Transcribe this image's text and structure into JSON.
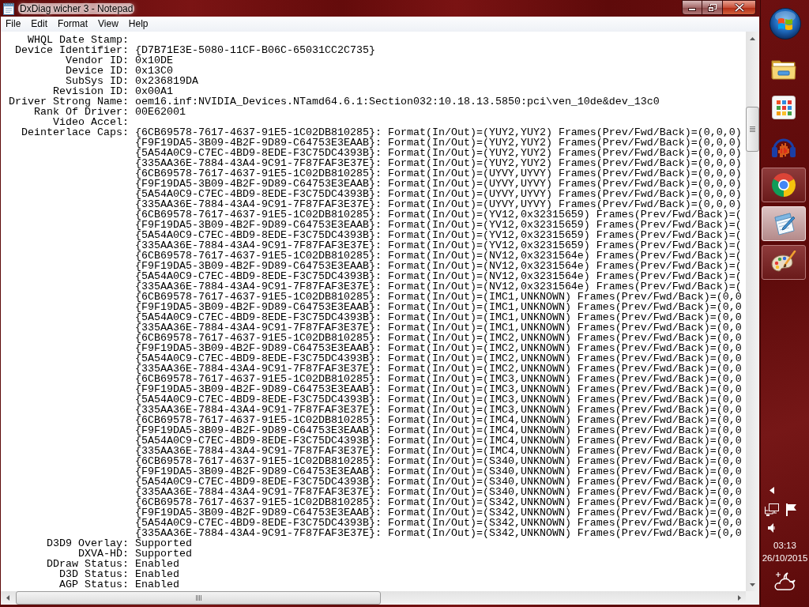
{
  "window": {
    "title": "DxDiag wicher 3 - Notepad"
  },
  "menu": [
    "File",
    "Edit",
    "Format",
    "View",
    "Help"
  ],
  "document": {
    "fields": [
      {
        "label": "WHQL Date Stamp:"
      },
      {
        "label": "Device Identifier:",
        "value": "{D7B71E3E-5080-11CF-B06C-65031CC2C735}"
      },
      {
        "label": "Vendor ID:",
        "value": "0x10DE"
      },
      {
        "label": "Device ID:",
        "value": "0x13C0"
      },
      {
        "label": "SubSys ID:",
        "value": "0x236819DA"
      },
      {
        "label": "Revision ID:",
        "value": "0x00A1"
      },
      {
        "label": "Driver Strong Name:",
        "value": "oem16.inf:NVIDIA_Devices.NTamd64.6.1:Section032:10.18.13.5850:pci\\ven_10de&dev_13c0"
      },
      {
        "label": "Rank Of Driver:",
        "value": "00E62001"
      },
      {
        "label": "Video Accel:"
      },
      {
        "label": "Deinterlace Caps:",
        "values": [
          "{6CB69578-7617-4637-91E5-1C02DB810285}: Format(In/Out)=(YUY2,YUY2) Frames(Prev/Fwd/Back)=(0,0,0)",
          "{F9F19DA5-3B09-4B2F-9D89-C64753E3EAAB}: Format(In/Out)=(YUY2,YUY2) Frames(Prev/Fwd/Back)=(0,0,0)",
          "{5A54A0C9-C7EC-4BD9-8EDE-F3C75DC4393B}: Format(In/Out)=(YUY2,YUY2) Frames(Prev/Fwd/Back)=(0,0,0)",
          "{335AA36E-7884-43A4-9C91-7F87FAF3E37E}: Format(In/Out)=(YUY2,YUY2) Frames(Prev/Fwd/Back)=(0,0,0)",
          "{6CB69578-7617-4637-91E5-1C02DB810285}: Format(In/Out)=(UYVY,UYVY) Frames(Prev/Fwd/Back)=(0,0,0)",
          "{F9F19DA5-3B09-4B2F-9D89-C64753E3EAAB}: Format(In/Out)=(UYVY,UYVY) Frames(Prev/Fwd/Back)=(0,0,0)",
          "{5A54A0C9-C7EC-4BD9-8EDE-F3C75DC4393B}: Format(In/Out)=(UYVY,UYVY) Frames(Prev/Fwd/Back)=(0,0,0)",
          "{335AA36E-7884-43A4-9C91-7F87FAF3E37E}: Format(In/Out)=(UYVY,UYVY) Frames(Prev/Fwd/Back)=(0,0,0)",
          "{6CB69578-7617-4637-91E5-1C02DB810285}: Format(In/Out)=(YV12,0x32315659) Frames(Prev/Fwd/Back)=(",
          "{F9F19DA5-3B09-4B2F-9D89-C64753E3EAAB}: Format(In/Out)=(YV12,0x32315659) Frames(Prev/Fwd/Back)=(",
          "{5A54A0C9-C7EC-4BD9-8EDE-F3C75DC4393B}: Format(In/Out)=(YV12,0x32315659) Frames(Prev/Fwd/Back)=(",
          "{335AA36E-7884-43A4-9C91-7F87FAF3E37E}: Format(In/Out)=(YV12,0x32315659) Frames(Prev/Fwd/Back)=(",
          "{6CB69578-7617-4637-91E5-1C02DB810285}: Format(In/Out)=(NV12,0x3231564e) Frames(Prev/Fwd/Back)=(",
          "{F9F19DA5-3B09-4B2F-9D89-C64753E3EAAB}: Format(In/Out)=(NV12,0x3231564e) Frames(Prev/Fwd/Back)=(",
          "{5A54A0C9-C7EC-4BD9-8EDE-F3C75DC4393B}: Format(In/Out)=(NV12,0x3231564e) Frames(Prev/Fwd/Back)=(",
          "{335AA36E-7884-43A4-9C91-7F87FAF3E37E}: Format(In/Out)=(NV12,0x3231564e) Frames(Prev/Fwd/Back)=(",
          "{6CB69578-7617-4637-91E5-1C02DB810285}: Format(In/Out)=(IMC1,UNKNOWN) Frames(Prev/Fwd/Back)=(0,0",
          "{F9F19DA5-3B09-4B2F-9D89-C64753E3EAAB}: Format(In/Out)=(IMC1,UNKNOWN) Frames(Prev/Fwd/Back)=(0,0",
          "{5A54A0C9-C7EC-4BD9-8EDE-F3C75DC4393B}: Format(In/Out)=(IMC1,UNKNOWN) Frames(Prev/Fwd/Back)=(0,0",
          "{335AA36E-7884-43A4-9C91-7F87FAF3E37E}: Format(In/Out)=(IMC1,UNKNOWN) Frames(Prev/Fwd/Back)=(0,0",
          "{6CB69578-7617-4637-91E5-1C02DB810285}: Format(In/Out)=(IMC2,UNKNOWN) Frames(Prev/Fwd/Back)=(0,0",
          "{F9F19DA5-3B09-4B2F-9D89-C64753E3EAAB}: Format(In/Out)=(IMC2,UNKNOWN) Frames(Prev/Fwd/Back)=(0,0",
          "{5A54A0C9-C7EC-4BD9-8EDE-F3C75DC4393B}: Format(In/Out)=(IMC2,UNKNOWN) Frames(Prev/Fwd/Back)=(0,0",
          "{335AA36E-7884-43A4-9C91-7F87FAF3E37E}: Format(In/Out)=(IMC2,UNKNOWN) Frames(Prev/Fwd/Back)=(0,0",
          "{6CB69578-7617-4637-91E5-1C02DB810285}: Format(In/Out)=(IMC3,UNKNOWN) Frames(Prev/Fwd/Back)=(0,0",
          "{F9F19DA5-3B09-4B2F-9D89-C64753E3EAAB}: Format(In/Out)=(IMC3,UNKNOWN) Frames(Prev/Fwd/Back)=(0,0",
          "{5A54A0C9-C7EC-4BD9-8EDE-F3C75DC4393B}: Format(In/Out)=(IMC3,UNKNOWN) Frames(Prev/Fwd/Back)=(0,0",
          "{335AA36E-7884-43A4-9C91-7F87FAF3E37E}: Format(In/Out)=(IMC3,UNKNOWN) Frames(Prev/Fwd/Back)=(0,0",
          "{6CB69578-7617-4637-91E5-1C02DB810285}: Format(In/Out)=(IMC4,UNKNOWN) Frames(Prev/Fwd/Back)=(0,0",
          "{F9F19DA5-3B09-4B2F-9D89-C64753E3EAAB}: Format(In/Out)=(IMC4,UNKNOWN) Frames(Prev/Fwd/Back)=(0,0",
          "{5A54A0C9-C7EC-4BD9-8EDE-F3C75DC4393B}: Format(In/Out)=(IMC4,UNKNOWN) Frames(Prev/Fwd/Back)=(0,0",
          "{335AA36E-7884-43A4-9C91-7F87FAF3E37E}: Format(In/Out)=(IMC4,UNKNOWN) Frames(Prev/Fwd/Back)=(0,0",
          "{6CB69578-7617-4637-91E5-1C02DB810285}: Format(In/Out)=(S340,UNKNOWN) Frames(Prev/Fwd/Back)=(0,0",
          "{F9F19DA5-3B09-4B2F-9D89-C64753E3EAAB}: Format(In/Out)=(S340,UNKNOWN) Frames(Prev/Fwd/Back)=(0,0",
          "{5A54A0C9-C7EC-4BD9-8EDE-F3C75DC4393B}: Format(In/Out)=(S340,UNKNOWN) Frames(Prev/Fwd/Back)=(0,0",
          "{335AA36E-7884-43A4-9C91-7F87FAF3E37E}: Format(In/Out)=(S340,UNKNOWN) Frames(Prev/Fwd/Back)=(0,0",
          "{6CB69578-7617-4637-91E5-1C02DB810285}: Format(In/Out)=(S342,UNKNOWN) Frames(Prev/Fwd/Back)=(0,0",
          "{F9F19DA5-3B09-4B2F-9D89-C64753E3EAAB}: Format(In/Out)=(S342,UNKNOWN) Frames(Prev/Fwd/Back)=(0,0",
          "{5A54A0C9-C7EC-4BD9-8EDE-F3C75DC4393B}: Format(In/Out)=(S342,UNKNOWN) Frames(Prev/Fwd/Back)=(0,0",
          "{335AA36E-7884-43A4-9C91-7F87FAF3E37E}: Format(In/Out)=(S342,UNKNOWN) Frames(Prev/Fwd/Back)=(0,0"
        ]
      },
      {
        "label": "D3D9 Overlay:",
        "value": "Supported"
      },
      {
        "label": "DXVA-HD:",
        "value": "Supported"
      },
      {
        "label": "DDraw Status:",
        "value": "Enabled"
      },
      {
        "label": "D3D Status:",
        "value": "Enabled"
      },
      {
        "label": "AGP Status:",
        "value": "Enabled"
      }
    ]
  },
  "taskbar": {
    "items": [
      {
        "running": false,
        "selected": false
      },
      {
        "running": false,
        "selected": false
      },
      {
        "running": false,
        "selected": false
      },
      {
        "running": true,
        "selected": false
      },
      {
        "running": true,
        "selected": true
      },
      {
        "running": true,
        "selected": false
      }
    ],
    "clock": {
      "time": "03:13",
      "date": "26/10/2015"
    }
  }
}
